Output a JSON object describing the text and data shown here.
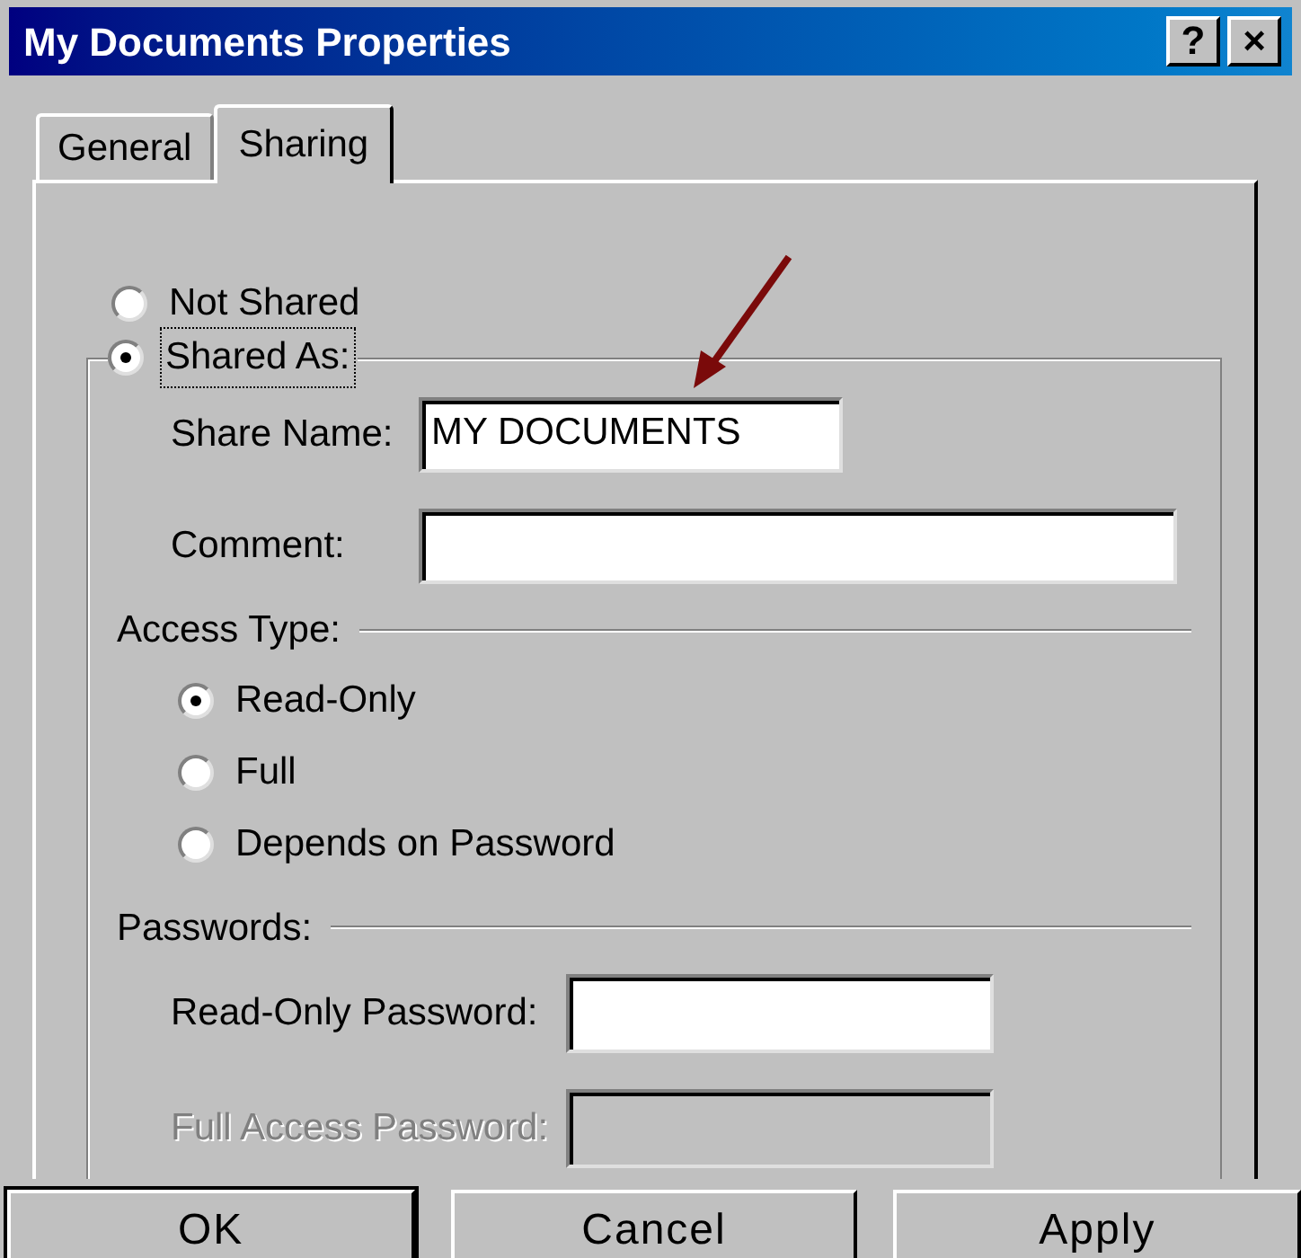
{
  "window": {
    "title": "My Documents Properties",
    "controls": [
      {
        "label": "?"
      },
      {
        "label": "×"
      }
    ]
  },
  "tabs": [
    {
      "label": "General",
      "selected": false
    },
    {
      "label": "Sharing",
      "selected": true
    }
  ],
  "sharing": [
    {
      "label": "Not Shared",
      "selected": false
    },
    {
      "label": "Shared As:",
      "selected": true
    }
  ],
  "share_name": {
    "label": "Share Name:",
    "value": "MY DOCUMENTS"
  },
  "comment": {
    "label": "Comment:"
  },
  "access_type": {
    "label": "Access Type:",
    "options": [
      {
        "label": "Read-Only",
        "selected": true
      },
      {
        "label": "Full",
        "selected": false
      },
      {
        "label": "Depends on Password",
        "selected": false
      }
    ]
  },
  "passwords": {
    "label": "Passwords:",
    "fields": [
      {
        "label": "Read-Only Password:",
        "disabled": false
      },
      {
        "label": "Full Access Password:",
        "disabled": true
      }
    ]
  },
  "buttons": [
    {
      "label": "OK",
      "default": true
    },
    {
      "label": "Cancel",
      "default": false
    },
    {
      "label": "Apply",
      "default": false
    }
  ]
}
